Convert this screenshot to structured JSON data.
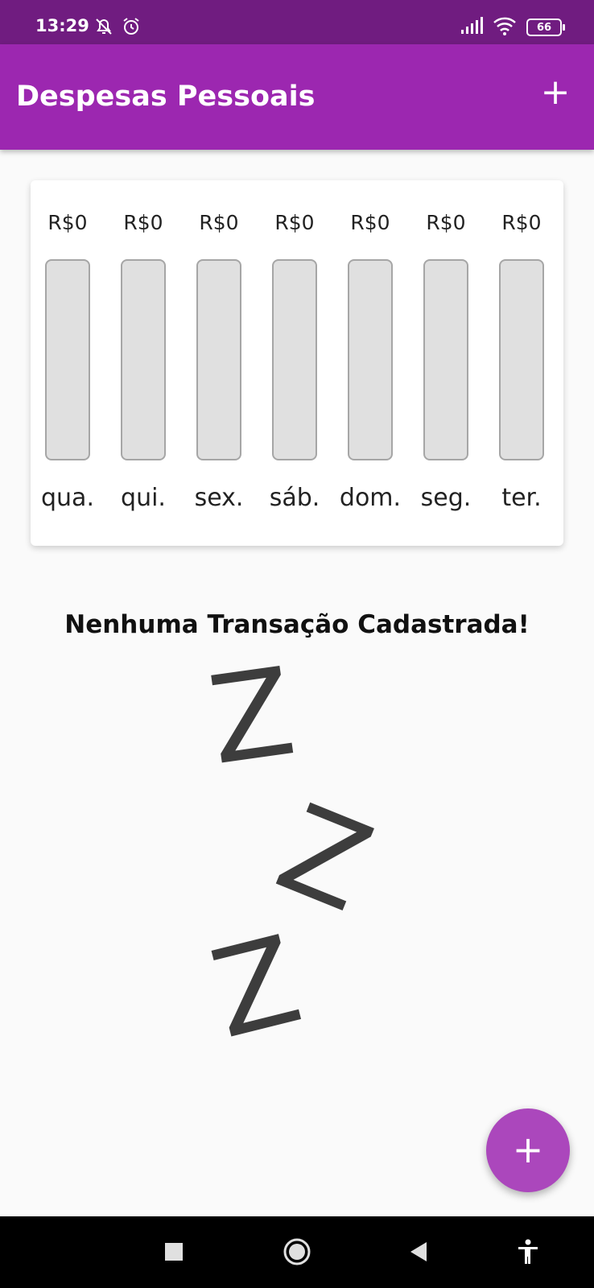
{
  "status_bar": {
    "time": "13:29",
    "battery": "66"
  },
  "app_bar": {
    "title": "Despesas Pessoais",
    "add_label": "+"
  },
  "chart_data": {
    "type": "bar",
    "categories": [
      "qua.",
      "qui.",
      "sex.",
      "sáb.",
      "dom.",
      "seg.",
      "ter."
    ],
    "values": [
      0,
      0,
      0,
      0,
      0,
      0,
      0
    ],
    "value_labels": [
      "R$0",
      "R$0",
      "R$0",
      "R$0",
      "R$0",
      "R$0",
      "R$0"
    ],
    "title": "",
    "xlabel": "",
    "ylabel": ""
  },
  "empty_state": {
    "message": "Nenhuma Transação Cadastrada!",
    "icon": "sleep-zzz-icon"
  },
  "fab": {
    "label": "+"
  },
  "nav_bar": {
    "icons": [
      "recents-square-icon",
      "home-circle-icon",
      "back-triangle-icon",
      "accessibility-icon"
    ]
  },
  "colors": {
    "status_bar": "#701c80",
    "app_bar": "#9c27b0",
    "fab": "#ab47bc",
    "bar_track": "#e0e0e0"
  }
}
